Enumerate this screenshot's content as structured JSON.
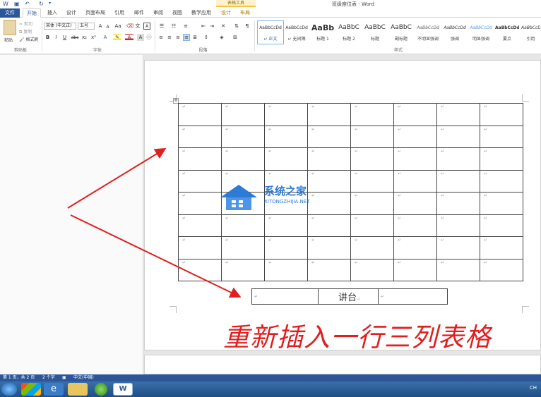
{
  "window": {
    "title": "班级座位表 - Word",
    "context_tools_label": "表格工具"
  },
  "tabs": [
    "文件",
    "开始",
    "插入",
    "设计",
    "页面布局",
    "引用",
    "邮件",
    "审阅",
    "视图",
    "教学应用",
    "设计",
    "布局"
  ],
  "ribbon": {
    "clipboard": {
      "paste": "粘贴",
      "cut": "剪切",
      "copy": "复制",
      "format_painter": "格式刷",
      "label": "剪贴板"
    },
    "font": {
      "font_name": "宋体 (中文正)",
      "font_size": "五号",
      "bold": "B",
      "italic": "I",
      "underline": "U",
      "strike": "abc",
      "subscript": "x₂",
      "superscript": "x²",
      "grow": "A",
      "shrink": "A",
      "case": "Aa",
      "label": "字体"
    },
    "paragraph": {
      "label": "段落"
    },
    "styles": {
      "label": "样式",
      "items": [
        {
          "sample": "AaBbCcDd",
          "name": "↵ 正文"
        },
        {
          "sample": "AaBbCcDd",
          "name": "↵ 无间隔"
        },
        {
          "sample": "AaBb",
          "name": "标题 1"
        },
        {
          "sample": "AaBbC",
          "name": "标题 2"
        },
        {
          "sample": "AaBbC",
          "name": "标题"
        },
        {
          "sample": "AaBbC",
          "name": "副标题"
        },
        {
          "sample": "AaBbCcDd",
          "name": "不明显强调"
        },
        {
          "sample": "AaBbCcDd",
          "name": "强调"
        },
        {
          "sample": "AaBbCcDd",
          "name": "明显强调"
        },
        {
          "sample": "AaBbCcDd",
          "name": "要点"
        },
        {
          "sample": "AaBbCcDd",
          "name": "引用"
        }
      ]
    }
  },
  "document": {
    "cell_mark": "↵",
    "table_rows": 8,
    "table_cols": 8,
    "podium_text": "讲台",
    "caption": "重新插入一行三列表格",
    "watermark_title": "系统之家",
    "watermark_sub": "XITONGZHIJIA.NET"
  },
  "statusbar": {
    "page": "第 1 页，共 2 页",
    "words": "2 个字",
    "language": "中文(中国)"
  },
  "taskbar": {
    "tray_text": "CH"
  },
  "colors": {
    "accent": "#2b579a",
    "caption": "#e02020",
    "watermark": "#2e7bd6"
  }
}
